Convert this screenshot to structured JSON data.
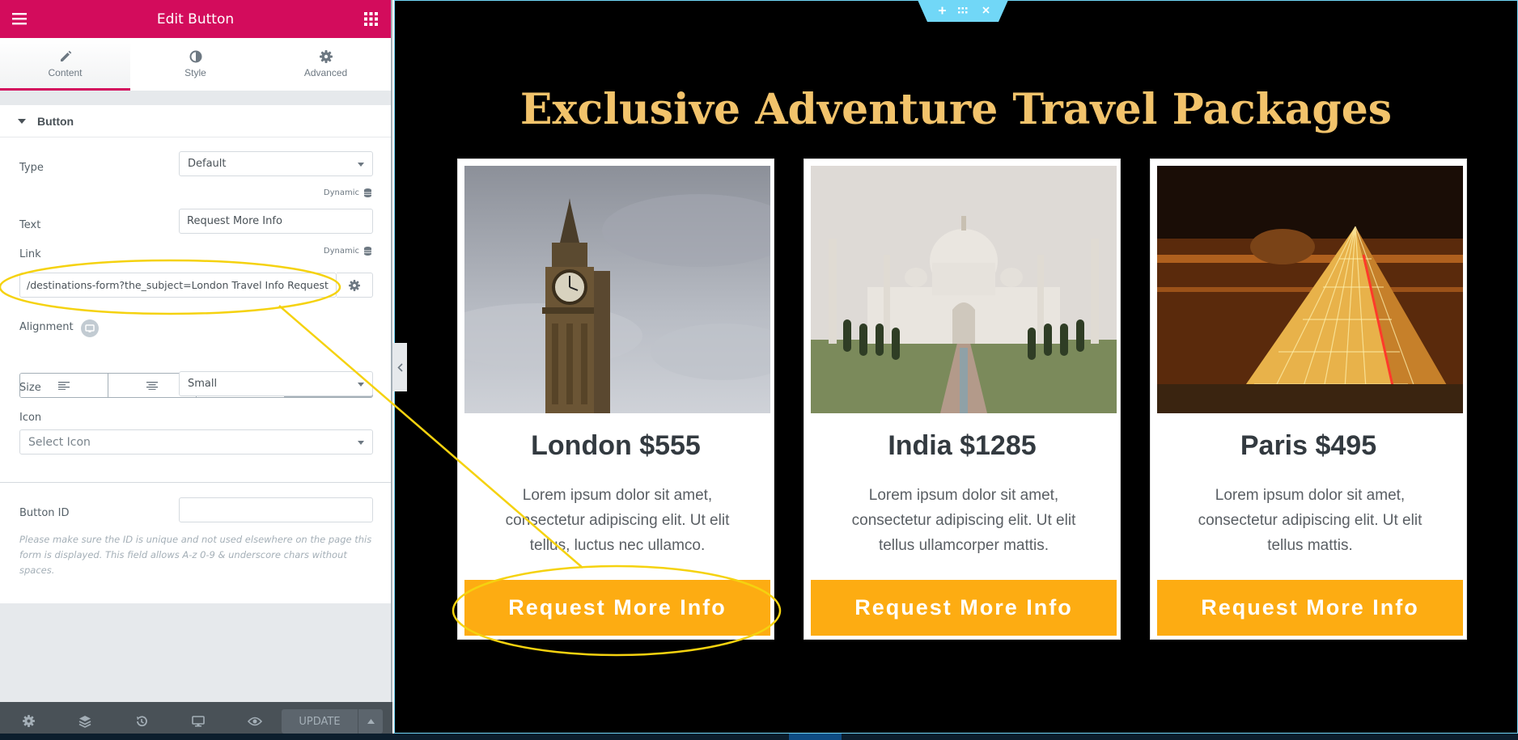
{
  "panel": {
    "header_title": "Edit Button",
    "tabs": [
      {
        "label": "Content",
        "icon": "pencil-icon"
      },
      {
        "label": "Style",
        "icon": "half-circle-icon"
      },
      {
        "label": "Advanced",
        "icon": "gear-icon"
      }
    ],
    "section_title": "Button",
    "controls": {
      "type_label": "Type",
      "type_value": "Default",
      "dynamic_label": "Dynamic",
      "text_label": "Text",
      "text_value": "Request More Info",
      "link_label": "Link",
      "link_value": "/destinations-form?the_subject=London Travel Info Request",
      "alignment_label": "Alignment",
      "alignment_selected": "justify",
      "size_label": "Size",
      "size_value": "Small",
      "icon_label": "Icon",
      "icon_placeholder": "Select Icon"
    },
    "button_id": {
      "label": "Button ID",
      "value": "",
      "note": "Please make sure the ID is unique and not used elsewhere on the page this form is displayed. This field allows A-z 0-9 & underscore chars without spaces."
    },
    "footer": {
      "update_label": "UPDATE"
    }
  },
  "preview": {
    "headline": "Exclusive Adventure Travel Packages",
    "cards": [
      {
        "title": "London $555",
        "body": "Lorem ipsum dolor sit amet, consectetur adipiscing elit. Ut elit tellus, luctus nec ullamco.",
        "button": "Request More Info"
      },
      {
        "title": "India $1285",
        "body": "Lorem ipsum dolor sit amet, consectetur adipiscing elit. Ut elit tellus ullamcorper mattis.",
        "button": "Request More Info"
      },
      {
        "title": "Paris $495",
        "body": "Lorem ipsum dolor sit amet, consectetur adipiscing elit. Ut elit tellus mattis.",
        "button": "Request More Info"
      }
    ]
  },
  "colors": {
    "header": "#d30c5c",
    "headline": "#f2c36b",
    "cta_button": "#fdac12",
    "annotation": "#f5d20f",
    "canvas": "#000000"
  }
}
